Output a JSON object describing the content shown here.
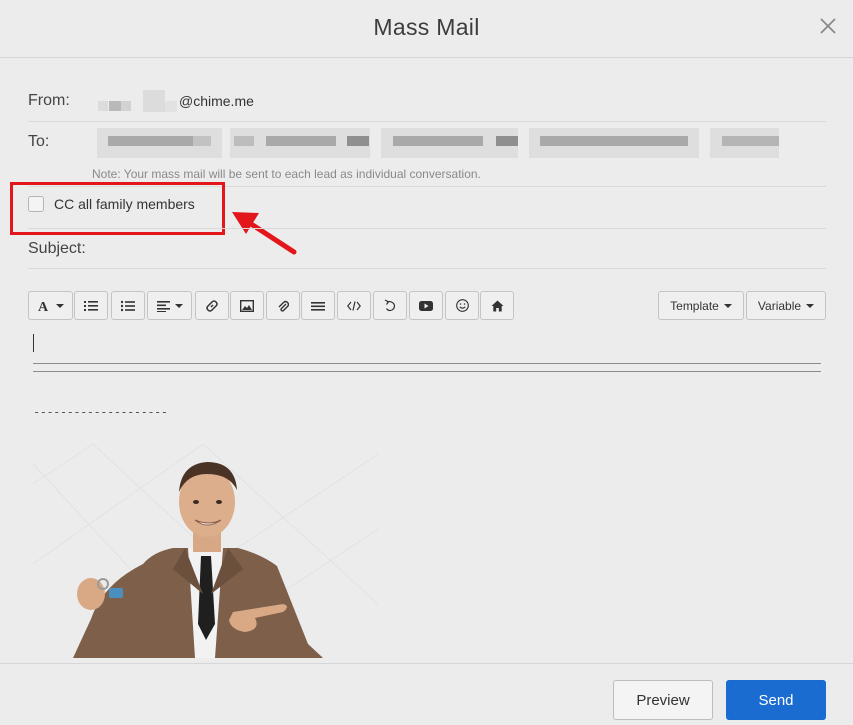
{
  "dialog": {
    "title": "Mass Mail",
    "close_icon": "close-icon"
  },
  "from": {
    "label": "From:",
    "value_suffix": "@chime.me"
  },
  "to": {
    "label": "To:",
    "note": "Note: Your mass mail will be sent to each lead as individual conversation."
  },
  "cc": {
    "label": "CC all family members",
    "checked": false
  },
  "subject": {
    "label": "Subject:",
    "value": ""
  },
  "toolbar": {
    "buttons": [
      "font-icon",
      "ordered-list-icon",
      "unordered-list-icon",
      "align-icon",
      "link-icon",
      "image-icon",
      "attachment-icon",
      "horizontal-rule-icon",
      "code-icon",
      "undo-icon",
      "video-icon",
      "emoji-icon",
      "home-icon"
    ],
    "template_label": "Template",
    "variable_label": "Variable"
  },
  "editor": {
    "signature_separator": "--------------------"
  },
  "footer": {
    "preview_label": "Preview",
    "send_label": "Send"
  },
  "colors": {
    "accent": "#1a6cd1",
    "highlight": "#e3161b"
  }
}
